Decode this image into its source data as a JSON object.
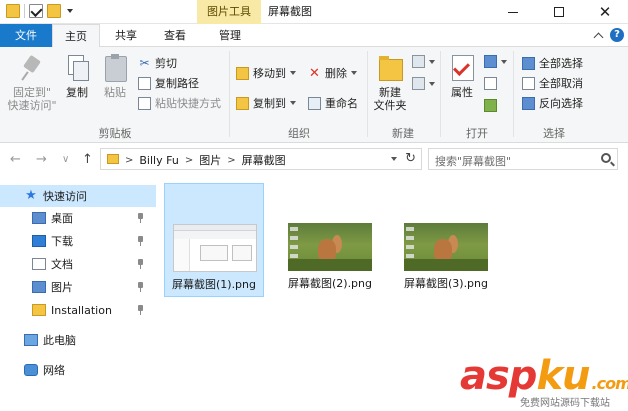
{
  "titlebar": {
    "context_group": "图片工具",
    "title": "屏幕截图",
    "close_glyph": "✕"
  },
  "tabs": {
    "file": "文件",
    "home": "主页",
    "share": "共享",
    "view": "查看",
    "manage": "管理"
  },
  "ribbon": {
    "clipboard": {
      "label": "剪贴板",
      "pin": "固定到\"\n快速访问\"",
      "pin_line1": "固定到\"",
      "pin_line2": "快速访问\"",
      "copy": "复制",
      "paste": "粘贴",
      "cut": "剪切",
      "copy_path": "复制路径",
      "paste_shortcut": "粘贴快捷方式"
    },
    "organize": {
      "label": "组织",
      "move_to": "移动到",
      "copy_to": "复制到",
      "delete": "删除",
      "rename": "重命名"
    },
    "new": {
      "label": "新建",
      "new_folder_line1": "新建",
      "new_folder_line2": "文件夹"
    },
    "open": {
      "label": "打开",
      "properties": "属性"
    },
    "select": {
      "label": "选择",
      "select_all": "全部选择",
      "select_none": "全部取消",
      "invert": "反向选择"
    }
  },
  "address": {
    "crumbs": [
      "Billy Fu",
      "图片",
      "屏幕截图"
    ],
    "crumb_sep": ">",
    "search_placeholder": "搜索\"屏幕截图\"",
    "back": "←",
    "forward": "→",
    "recent": "∨",
    "up": "↑",
    "refresh": "↻"
  },
  "navpane": {
    "items": [
      {
        "label": "快速访问"
      },
      {
        "label": "桌面"
      },
      {
        "label": "下载"
      },
      {
        "label": "文档"
      },
      {
        "label": "图片"
      },
      {
        "label": "Installation"
      },
      {
        "label": "此电脑"
      },
      {
        "label": "网络"
      }
    ]
  },
  "files": [
    {
      "name": "屏幕截图(1).png"
    },
    {
      "name": "屏幕截图(2).png"
    },
    {
      "name": "屏幕截图(3).png"
    }
  ],
  "watermark": {
    "brand_a": "asp",
    "brand_b": "ku",
    "brand_c": ".com",
    "sub": "免费网站源码下载站"
  }
}
